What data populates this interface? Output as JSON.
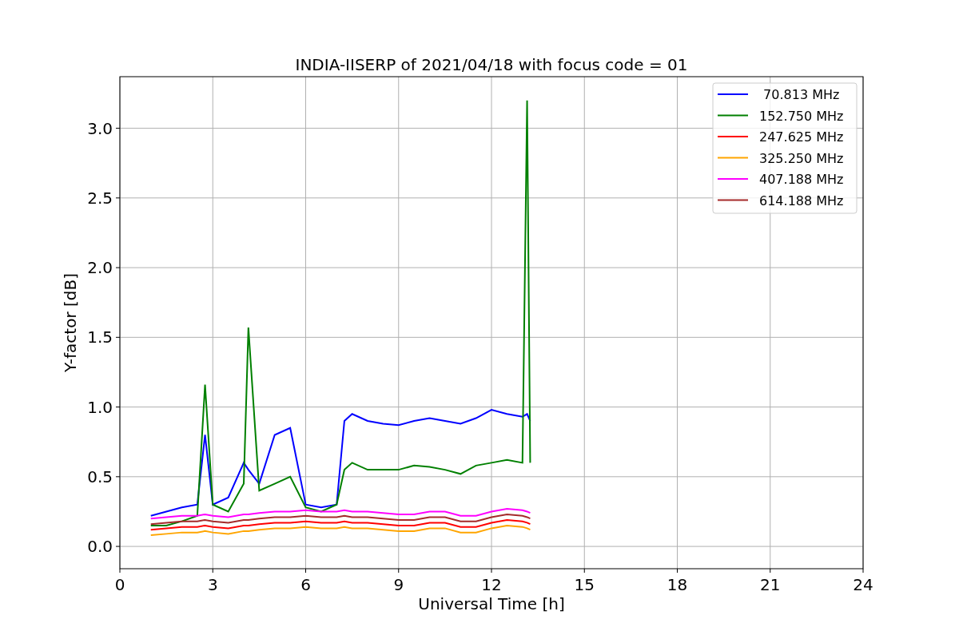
{
  "chart_data": {
    "type": "line",
    "title": "INDIA-IISERP of 2021/04/18 with focus code = 01",
    "xlabel": "Universal Time [h]",
    "ylabel": "Y-factor [dB]",
    "x": [
      1,
      1.5,
      2,
      2.5,
      2.75,
      3,
      3.5,
      4,
      4.15,
      4.5,
      5,
      5.5,
      6,
      6.5,
      7,
      7.25,
      7.5,
      8,
      8.5,
      9,
      9.5,
      10,
      10.5,
      11,
      11.5,
      12,
      12.5,
      13,
      13.15,
      13.25
    ],
    "series": [
      {
        "name": " 70.813 MHz",
        "color": "#0000ff",
        "values": [
          0.22,
          0.25,
          0.28,
          0.3,
          0.8,
          0.3,
          0.35,
          0.6,
          0.55,
          0.45,
          0.8,
          0.85,
          0.3,
          0.28,
          0.3,
          0.9,
          0.95,
          0.9,
          0.88,
          0.87,
          0.9,
          0.92,
          0.9,
          0.88,
          0.92,
          0.98,
          0.95,
          0.93,
          0.95,
          0.9
        ]
      },
      {
        "name": "152.750 MHz",
        "color": "#008000",
        "values": [
          0.15,
          0.15,
          0.18,
          0.22,
          1.16,
          0.3,
          0.25,
          0.45,
          1.57,
          0.4,
          0.45,
          0.5,
          0.28,
          0.25,
          0.3,
          0.55,
          0.6,
          0.55,
          0.55,
          0.55,
          0.58,
          0.57,
          0.55,
          0.52,
          0.58,
          0.6,
          0.62,
          0.6,
          3.2,
          0.6
        ]
      },
      {
        "name": "247.625 MHz",
        "color": "#ff0000",
        "values": [
          0.12,
          0.13,
          0.14,
          0.14,
          0.15,
          0.14,
          0.13,
          0.15,
          0.15,
          0.16,
          0.17,
          0.17,
          0.18,
          0.17,
          0.17,
          0.18,
          0.17,
          0.17,
          0.16,
          0.15,
          0.15,
          0.17,
          0.17,
          0.14,
          0.14,
          0.17,
          0.19,
          0.18,
          0.17,
          0.16
        ]
      },
      {
        "name": "325.250 MHz",
        "color": "#ffa500",
        "values": [
          0.08,
          0.09,
          0.1,
          0.1,
          0.11,
          0.1,
          0.09,
          0.11,
          0.11,
          0.12,
          0.13,
          0.13,
          0.14,
          0.13,
          0.13,
          0.14,
          0.13,
          0.13,
          0.12,
          0.11,
          0.11,
          0.13,
          0.13,
          0.1,
          0.1,
          0.13,
          0.15,
          0.14,
          0.13,
          0.12
        ]
      },
      {
        "name": "407.188 MHz",
        "color": "#ff00ff",
        "values": [
          0.2,
          0.21,
          0.22,
          0.22,
          0.23,
          0.22,
          0.21,
          0.23,
          0.23,
          0.24,
          0.25,
          0.25,
          0.26,
          0.25,
          0.25,
          0.26,
          0.25,
          0.25,
          0.24,
          0.23,
          0.23,
          0.25,
          0.25,
          0.22,
          0.22,
          0.25,
          0.27,
          0.26,
          0.25,
          0.24
        ]
      },
      {
        "name": "614.188 MHz",
        "color": "#a52a2a",
        "values": [
          0.16,
          0.17,
          0.18,
          0.18,
          0.19,
          0.18,
          0.17,
          0.19,
          0.19,
          0.2,
          0.21,
          0.21,
          0.22,
          0.21,
          0.21,
          0.22,
          0.21,
          0.21,
          0.2,
          0.19,
          0.19,
          0.21,
          0.21,
          0.18,
          0.18,
          0.21,
          0.23,
          0.22,
          0.21,
          0.2
        ]
      }
    ],
    "grid": true,
    "legend": "upper right",
    "xlim": [
      0,
      24
    ],
    "ylim": [
      -0.16,
      3.37
    ],
    "xticks": [
      0,
      3,
      6,
      9,
      12,
      15,
      18,
      21,
      24
    ],
    "yticks": [
      {
        "value": 0,
        "label": "0.0"
      },
      {
        "value": 0.5,
        "label": "0.5"
      },
      {
        "value": 1,
        "label": "1.0"
      },
      {
        "value": 1.5,
        "label": "1.5"
      },
      {
        "value": 2,
        "label": "2.0"
      },
      {
        "value": 2.5,
        "label": "2.5"
      },
      {
        "value": 3,
        "label": "3.0"
      }
    ]
  }
}
